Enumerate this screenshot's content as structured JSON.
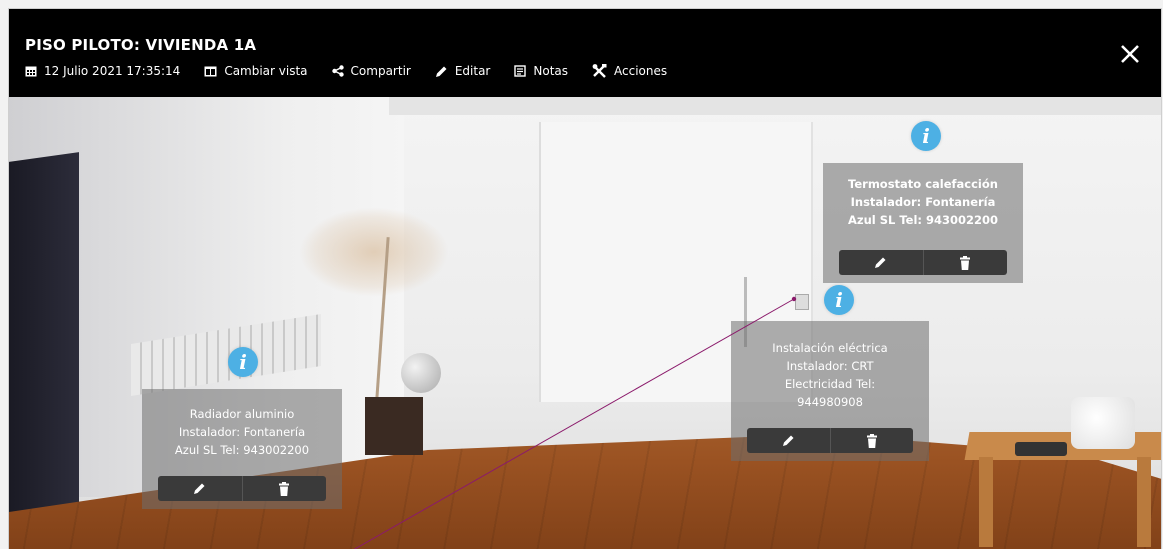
{
  "header": {
    "title": "PISO PILOTO: VIVIENDA 1A",
    "date": "12 Julio 2021 17:35:14",
    "toolbar": {
      "change_view": "Cambiar vista",
      "share": "Compartir",
      "edit": "Editar",
      "notes": "Notas",
      "actions": "Acciones"
    }
  },
  "hotspots": [
    {
      "icon": "info-icon",
      "lines": [
        "Termostato calefacción",
        "Instalador: Fontanería",
        "Azul SL Tel: 943002200"
      ]
    },
    {
      "icon": "info-icon",
      "lines": [
        "Instalación eléctrica",
        "Instalador: CRT",
        "Electricidad Tel:",
        "944980908"
      ]
    },
    {
      "icon": "info-icon",
      "lines": [
        "Radiador aluminio",
        "Instalador: Fontanería",
        "Azul SL Tel: 943002200"
      ]
    }
  ],
  "icons": {
    "info_glyph": "i"
  },
  "colors": {
    "info_accent": "#4db0e4",
    "topbar": "#000000",
    "pointer_line": "#8b1a6b"
  }
}
